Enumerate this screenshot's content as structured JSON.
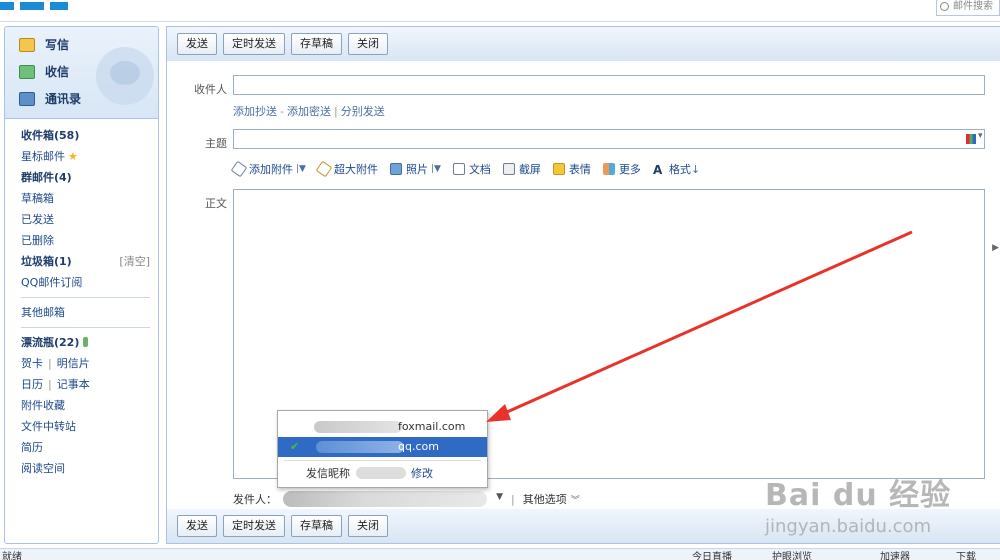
{
  "top": {
    "search_placeholder": "邮件搜索"
  },
  "sidebar": {
    "write": "写信",
    "receive": "收信",
    "contacts": "通讯录",
    "folders": [
      {
        "label": "收件箱(58)",
        "bold": true
      },
      {
        "label": "星标邮件",
        "star": true
      },
      {
        "label": "群邮件(4)",
        "bold": true
      },
      {
        "label": "草稿箱"
      },
      {
        "label": "已发送"
      },
      {
        "label": "已删除"
      },
      {
        "label": "垃圾箱(1)",
        "bold": true,
        "extra": "[清空]"
      },
      {
        "label": "QQ邮件订阅"
      }
    ],
    "other_mailbox": "其他邮箱",
    "drift_bottle": "漂流瓶(22)",
    "card": "贺卡",
    "postcard": "明信片",
    "calendar": "日历",
    "notebook": "记事本",
    "attachments": "附件收藏",
    "file_transfer": "文件中转站",
    "resume": "简历",
    "reading": "阅读空间"
  },
  "toolbar": {
    "send": "发送",
    "schedule": "定时发送",
    "draft": "存草稿",
    "close": "关闭"
  },
  "compose": {
    "to_label": "收件人",
    "add_cc": "添加抄送",
    "add_bcc": "添加密送",
    "separate": "分别发送",
    "subject_label": "主题",
    "body_label": "正文",
    "format": {
      "attach": "添加附件",
      "big_attach": "超大附件",
      "photo": "照片",
      "doc": "文档",
      "screenshot": "截屏",
      "emoji": "表情",
      "more": "更多",
      "style": "格式"
    },
    "sender_label": "发件人：",
    "other_options": "其他选项"
  },
  "dropdown": {
    "options": [
      {
        "suffix": "foxmail.com",
        "selected": false
      },
      {
        "suffix": "qq.com",
        "selected": true
      }
    ],
    "nickname_label": "发信昵称",
    "edit": "修改"
  },
  "status": {
    "left": "就绪",
    "item1": "今日直播",
    "item2": "护眼浏览",
    "item3": "加速器",
    "item4": "下载"
  },
  "watermark": {
    "brand": "Bai du 经验",
    "url": "jingyan.baidu.com"
  }
}
